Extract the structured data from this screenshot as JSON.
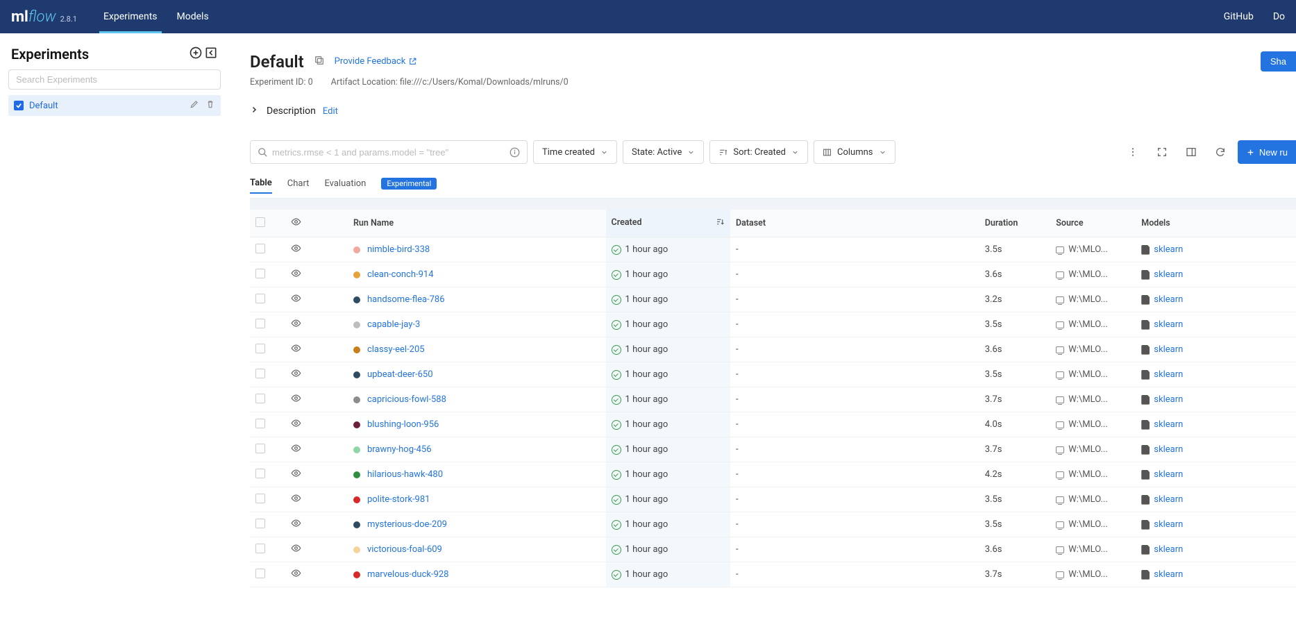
{
  "topbar": {
    "version": "2.8.1",
    "nav": {
      "experiments": "Experiments",
      "models": "Models"
    },
    "right": {
      "github": "GitHub",
      "docs": "Do"
    }
  },
  "sidebar": {
    "title": "Experiments",
    "search_placeholder": "Search Experiments",
    "items": [
      {
        "name": "Default"
      }
    ]
  },
  "page": {
    "title": "Default",
    "feedback": "Provide Feedback",
    "share": "Sha",
    "exp_id_label": "Experiment ID: 0",
    "artifact_label": "Artifact Location: file:///c:/Users/Komal/Downloads/mlruns/0",
    "description_label": "Description",
    "edit": "Edit"
  },
  "controls": {
    "search_placeholder": "metrics.rmse < 1 and params.model = \"tree\"",
    "time": "Time created",
    "state": "State: Active",
    "sort": "Sort: Created",
    "columns": "Columns",
    "newrun": "New ru"
  },
  "tabs": {
    "table": "Table",
    "chart": "Chart",
    "evaluation": "Evaluation",
    "experimental": "Experimental"
  },
  "table": {
    "headers": {
      "run": "Run Name",
      "created": "Created",
      "dataset": "Dataset",
      "duration": "Duration",
      "source": "Source",
      "models": "Models"
    },
    "rows": [
      {
        "color": "#f2a8a0",
        "name": "nimble-bird-338",
        "created": "1 hour ago",
        "dataset": "-",
        "duration": "3.5s",
        "source": "W:\\MLO...",
        "model": "sklearn"
      },
      {
        "color": "#e8a23c",
        "name": "clean-conch-914",
        "created": "1 hour ago",
        "dataset": "-",
        "duration": "3.6s",
        "source": "W:\\MLO...",
        "model": "sklearn"
      },
      {
        "color": "#2f4a63",
        "name": "handsome-flea-786",
        "created": "1 hour ago",
        "dataset": "-",
        "duration": "3.2s",
        "source": "W:\\MLO...",
        "model": "sklearn"
      },
      {
        "color": "#bdbdbd",
        "name": "capable-jay-3",
        "created": "1 hour ago",
        "dataset": "-",
        "duration": "3.5s",
        "source": "W:\\MLO...",
        "model": "sklearn"
      },
      {
        "color": "#c77f1a",
        "name": "classy-eel-205",
        "created": "1 hour ago",
        "dataset": "-",
        "duration": "3.6s",
        "source": "W:\\MLO...",
        "model": "sklearn"
      },
      {
        "color": "#2f4a63",
        "name": "upbeat-deer-650",
        "created": "1 hour ago",
        "dataset": "-",
        "duration": "3.5s",
        "source": "W:\\MLO...",
        "model": "sklearn"
      },
      {
        "color": "#8c8c8c",
        "name": "capricious-fowl-588",
        "created": "1 hour ago",
        "dataset": "-",
        "duration": "3.7s",
        "source": "W:\\MLO...",
        "model": "sklearn"
      },
      {
        "color": "#6b1f3a",
        "name": "blushing-loon-956",
        "created": "1 hour ago",
        "dataset": "-",
        "duration": "4.0s",
        "source": "W:\\MLO...",
        "model": "sklearn"
      },
      {
        "color": "#8fd6a5",
        "name": "brawny-hog-456",
        "created": "1 hour ago",
        "dataset": "-",
        "duration": "3.7s",
        "source": "W:\\MLO...",
        "model": "sklearn"
      },
      {
        "color": "#2f8f3f",
        "name": "hilarious-hawk-480",
        "created": "1 hour ago",
        "dataset": "-",
        "duration": "4.2s",
        "source": "W:\\MLO...",
        "model": "sklearn"
      },
      {
        "color": "#d62a2a",
        "name": "polite-stork-981",
        "created": "1 hour ago",
        "dataset": "-",
        "duration": "3.5s",
        "source": "W:\\MLO...",
        "model": "sklearn"
      },
      {
        "color": "#2f4a63",
        "name": "mysterious-doe-209",
        "created": "1 hour ago",
        "dataset": "-",
        "duration": "3.5s",
        "source": "W:\\MLO...",
        "model": "sklearn"
      },
      {
        "color": "#f4d49b",
        "name": "victorious-foal-609",
        "created": "1 hour ago",
        "dataset": "-",
        "duration": "3.6s",
        "source": "W:\\MLO...",
        "model": "sklearn"
      },
      {
        "color": "#d62a2a",
        "name": "marvelous-duck-928",
        "created": "1 hour ago",
        "dataset": "-",
        "duration": "3.7s",
        "source": "W:\\MLO...",
        "model": "sklearn"
      }
    ]
  }
}
